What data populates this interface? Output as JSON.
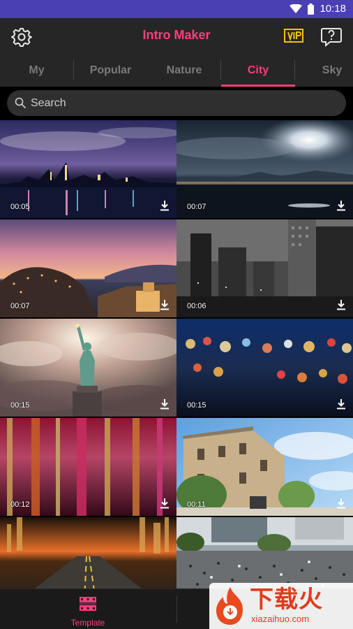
{
  "status": {
    "time": "10:18"
  },
  "app": {
    "title": "Intro Maker"
  },
  "icons": {
    "settings": "gear-icon",
    "vip": "vip-badge-icon",
    "help": "help-bubble-icon",
    "search": "search-icon",
    "download": "download-icon",
    "template": "film-strip-icon"
  },
  "tabs": [
    {
      "label": "My"
    },
    {
      "label": "Popular"
    },
    {
      "label": "Nature"
    },
    {
      "label": "City",
      "active": true
    },
    {
      "label": "Sky"
    }
  ],
  "search": {
    "placeholder": "Search"
  },
  "videos": [
    {
      "duration": "00:05",
      "scene": "night city skyline"
    },
    {
      "duration": "00:07",
      "scene": "moonlit coast"
    },
    {
      "duration": "00:07",
      "scene": "sunset coastal town"
    },
    {
      "duration": "00:06",
      "scene": "monochrome skyscrapers"
    },
    {
      "duration": "00:15",
      "scene": "statue of liberty"
    },
    {
      "duration": "00:15",
      "scene": "city bokeh lights"
    },
    {
      "duration": "00:12",
      "scene": "neon wet street"
    },
    {
      "duration": "00:11",
      "scene": "stone building"
    },
    {
      "duration": "",
      "scene": "highway at dusk"
    },
    {
      "duration": "",
      "scene": "crowded crossing"
    }
  ],
  "bottom_nav": {
    "template_label": "Template"
  },
  "watermark": {
    "text": "下载火",
    "url": "xiazaihuo.com"
  },
  "colors": {
    "accent": "#ff3d7f",
    "status_bar": "#4a3fb3",
    "app_bar": "#262626"
  }
}
